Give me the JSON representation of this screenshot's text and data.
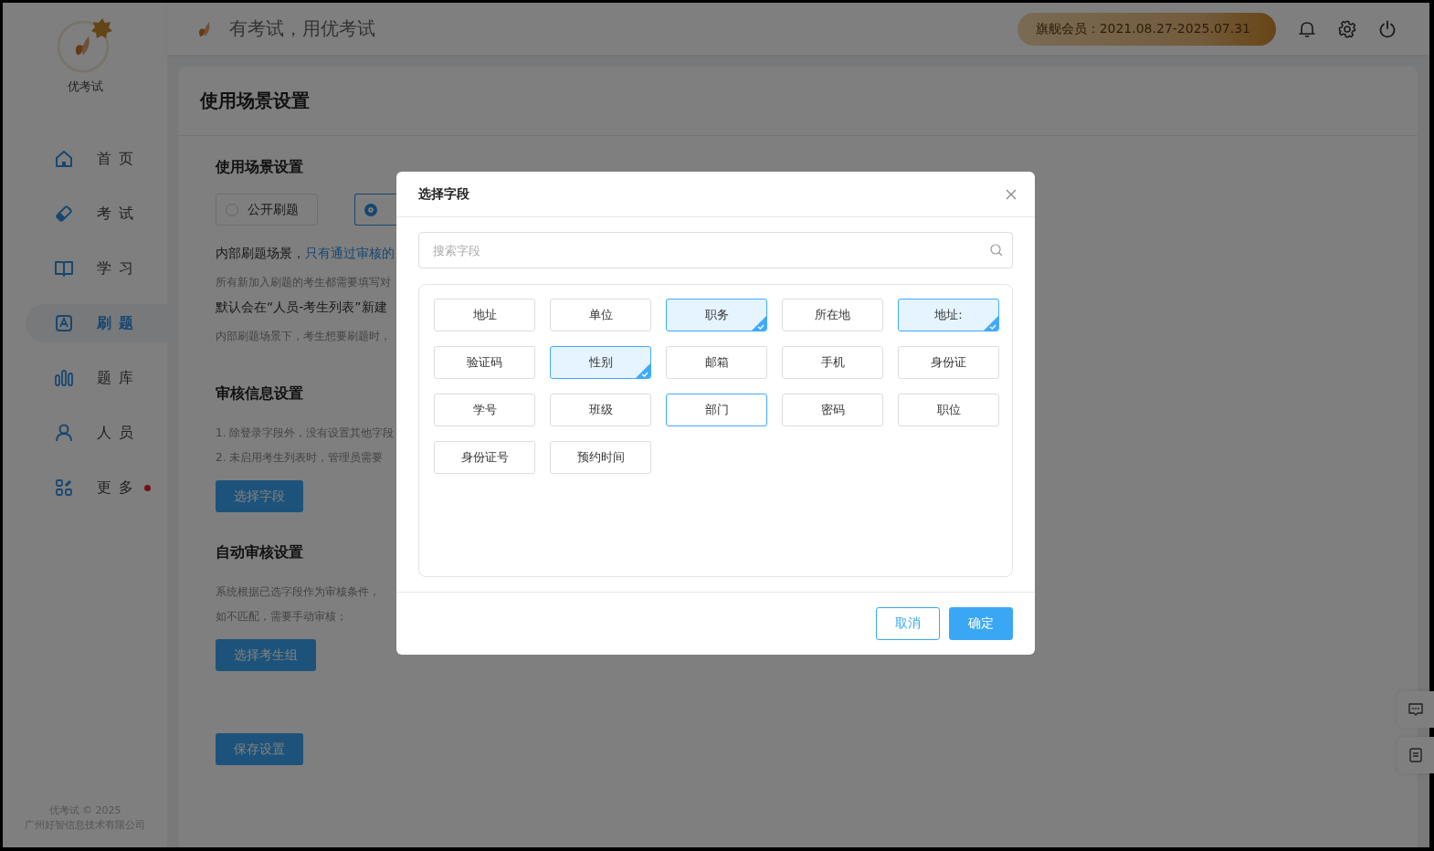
{
  "app": {
    "name": "优考试",
    "slogan": "有考试，用优考试",
    "membership": "旗舰会员：2021.08.27-2025.07.31"
  },
  "sidebar": {
    "items": [
      {
        "label": "首页",
        "kind": "home",
        "selected": false,
        "dot": false
      },
      {
        "label": "考试",
        "kind": "eraser",
        "selected": false,
        "dot": false
      },
      {
        "label": "学习",
        "kind": "book",
        "selected": false,
        "dot": false
      },
      {
        "label": "刷题",
        "kind": "quiz",
        "selected": true,
        "dot": false
      },
      {
        "label": "题库",
        "kind": "bars",
        "selected": false,
        "dot": false
      },
      {
        "label": "人员",
        "kind": "person",
        "selected": false,
        "dot": false
      },
      {
        "label": "更多",
        "kind": "apps",
        "selected": false,
        "dot": true
      }
    ],
    "footer": [
      "优考试 © 2025",
      "广州好智信息技术有限公司"
    ]
  },
  "page": {
    "title": "使用场景设置",
    "sections": [
      {
        "heading": "使用场景设置",
        "radios": [
          {
            "label": "公开刷题",
            "selected": false
          },
          {
            "selected": true
          }
        ],
        "lines": [
          {
            "kind": "lead",
            "text": "内部刷题场景，",
            "link": "只有通过审核的"
          },
          {
            "kind": "note",
            "text": "所有新加入刷题的考生都需要填写对"
          },
          {
            "kind": "lead",
            "text": "默认会在“人员-考生列表”新建"
          },
          {
            "kind": "note",
            "text": "内部刷题场景下，考生想要刷题时，"
          }
        ]
      },
      {
        "heading": "审核信息设置",
        "lines": [
          {
            "kind": "note",
            "text": "1. 除登录字段外，没有设置其他字段"
          },
          {
            "kind": "note",
            "text": "2. 未启用考生列表时，管理员需要"
          }
        ],
        "button": "选择字段"
      },
      {
        "heading": "自动审核设置",
        "lines": [
          {
            "kind": "note",
            "text": "系统根据已选字段作为审核条件，"
          },
          {
            "kind": "note",
            "text": "如不匹配，需要手动审核；"
          }
        ],
        "button": "选择考生组"
      }
    ],
    "save_button": "保存设置"
  },
  "dialog": {
    "title": "选择字段",
    "search": {
      "placeholder": "搜索字段"
    },
    "fields": [
      {
        "label": "地址",
        "selected": false,
        "highlighted": false
      },
      {
        "label": "单位",
        "selected": false,
        "highlighted": false
      },
      {
        "label": "职务",
        "selected": true,
        "highlighted": false
      },
      {
        "label": "所在地",
        "selected": false,
        "highlighted": false
      },
      {
        "label": "地址:",
        "selected": true,
        "highlighted": false
      },
      {
        "label": "验证码",
        "selected": false,
        "highlighted": false
      },
      {
        "label": "性别",
        "selected": true,
        "highlighted": false
      },
      {
        "label": "邮箱",
        "selected": false,
        "highlighted": false
      },
      {
        "label": "手机",
        "selected": false,
        "highlighted": false
      },
      {
        "label": "身份证",
        "selected": false,
        "highlighted": false
      },
      {
        "label": "学号",
        "selected": false,
        "highlighted": false
      },
      {
        "label": "班级",
        "selected": false,
        "highlighted": false
      },
      {
        "label": "部门",
        "selected": false,
        "highlighted": true
      },
      {
        "label": "密码",
        "selected": false,
        "highlighted": false
      },
      {
        "label": "职位",
        "selected": false,
        "highlighted": false
      },
      {
        "label": "身份证号",
        "selected": false,
        "highlighted": false
      },
      {
        "label": "预约时间",
        "selected": false,
        "highlighted": false
      }
    ],
    "buttons": [
      {
        "label": "取消",
        "kind": "secondary"
      },
      {
        "label": "确定",
        "kind": "primary"
      }
    ]
  }
}
